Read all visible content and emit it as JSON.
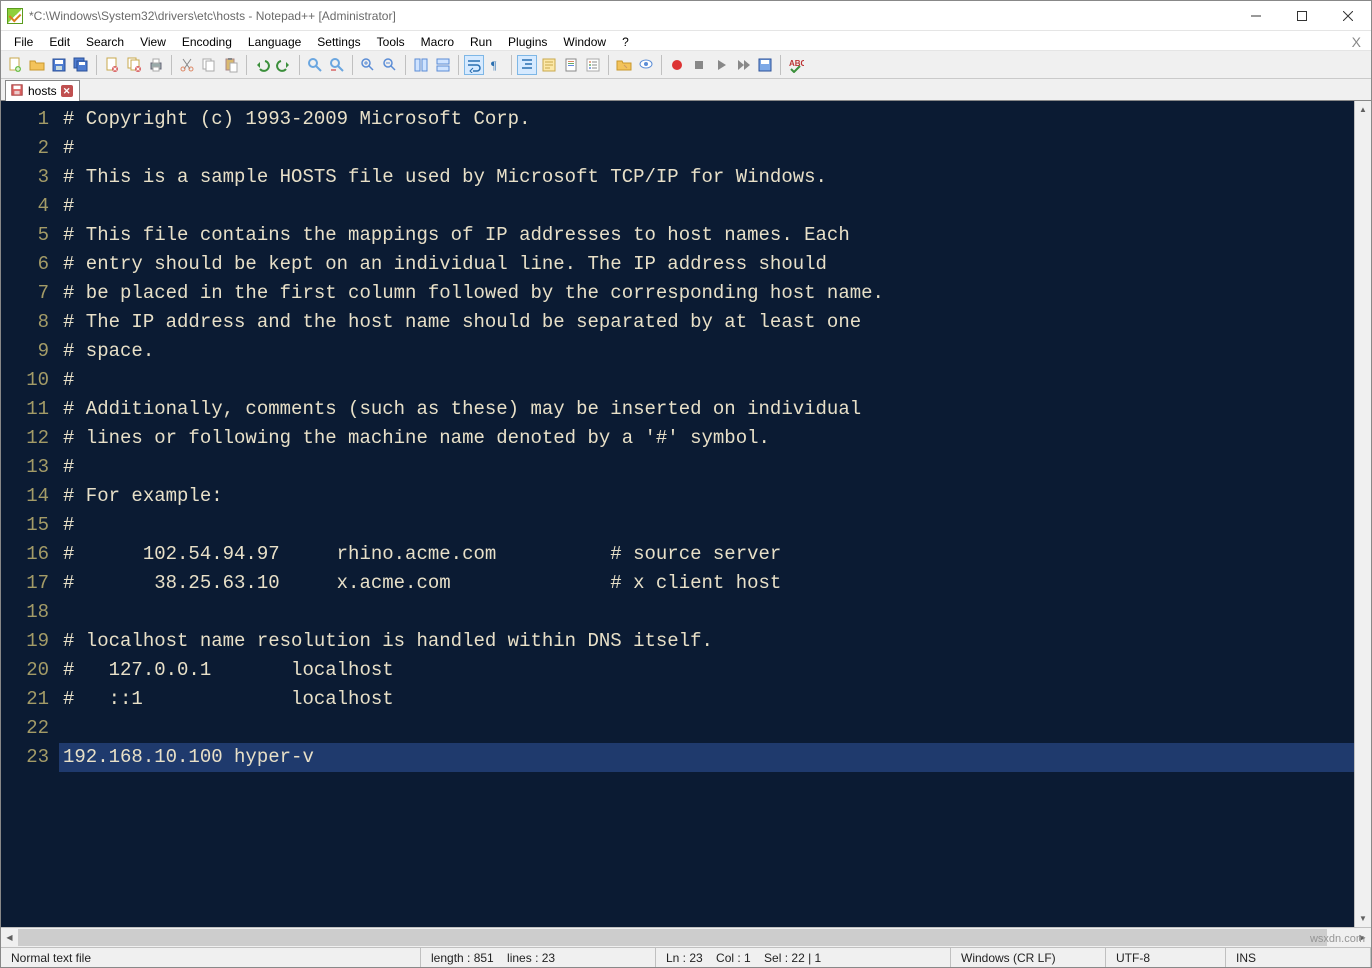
{
  "title": "*C:\\Windows\\System32\\drivers\\etc\\hosts - Notepad++ [Administrator]",
  "menu": [
    "File",
    "Edit",
    "Search",
    "View",
    "Encoding",
    "Language",
    "Settings",
    "Tools",
    "Macro",
    "Run",
    "Plugins",
    "Window",
    "?"
  ],
  "tab": {
    "label": "hosts"
  },
  "lines": [
    "# Copyright (c) 1993-2009 Microsoft Corp.",
    "#",
    "# This is a sample HOSTS file used by Microsoft TCP/IP for Windows.",
    "#",
    "# This file contains the mappings of IP addresses to host names. Each",
    "# entry should be kept on an individual line. The IP address should",
    "# be placed in the first column followed by the corresponding host name.",
    "# The IP address and the host name should be separated by at least one",
    "# space.",
    "#",
    "# Additionally, comments (such as these) may be inserted on individual",
    "# lines or following the machine name denoted by a '#' symbol.",
    "#",
    "# For example:",
    "#",
    "#      102.54.94.97     rhino.acme.com          # source server",
    "#       38.25.63.10     x.acme.com              # x client host",
    "",
    "# localhost name resolution is handled within DNS itself.",
    "#   127.0.0.1       localhost",
    "#   ::1             localhost",
    "",
    "192.168.10.100 hyper-v"
  ],
  "active_line": 23,
  "status": {
    "filetype": "Normal text file",
    "length_label": "length : 851    lines : 23",
    "pos_label": "Ln : 23    Col : 1    Sel : 22 | 1",
    "eol": "Windows (CR LF)",
    "encoding": "UTF-8",
    "mode": "INS"
  },
  "watermark": "wsxdn.com"
}
